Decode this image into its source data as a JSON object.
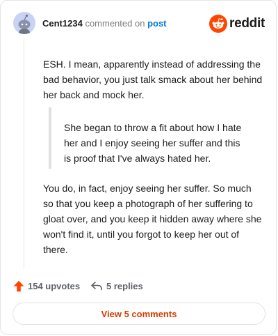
{
  "colors": {
    "accent": "#d93a00",
    "reddit_orange": "#ff4500",
    "link": "#0079d3",
    "muted": "#7c7c7c",
    "avatar_bg": "#c9d2f4"
  },
  "header": {
    "username": "Cent1234",
    "action_text": "commented on",
    "post_link": "post",
    "brand": "reddit",
    "avatar_icon": "snoo-avatar-icon",
    "brand_icon": "reddit-logo-icon"
  },
  "comment": {
    "paragraph1": "ESH. I mean, apparently instead of addressing the bad behavior, you just talk smack about her behind her back and mock her.",
    "quote": "She began to throw a fit about how I hate her and I enjoy seeing her suffer and this is proof that I've always hated her.",
    "paragraph2": "You do, in fact, enjoy seeing her suffer. So much so that you keep a photograph of her suffering to gloat over, and you keep it hidden away where she won't find it, until you forgot to keep her out of there."
  },
  "actions": {
    "upvotes": "154 upvotes",
    "replies": "5 replies",
    "upvote_icon": "upvote-arrow-icon",
    "reply_icon": "reply-arrow-icon"
  },
  "footer": {
    "view_comments": "View 5 comments"
  }
}
